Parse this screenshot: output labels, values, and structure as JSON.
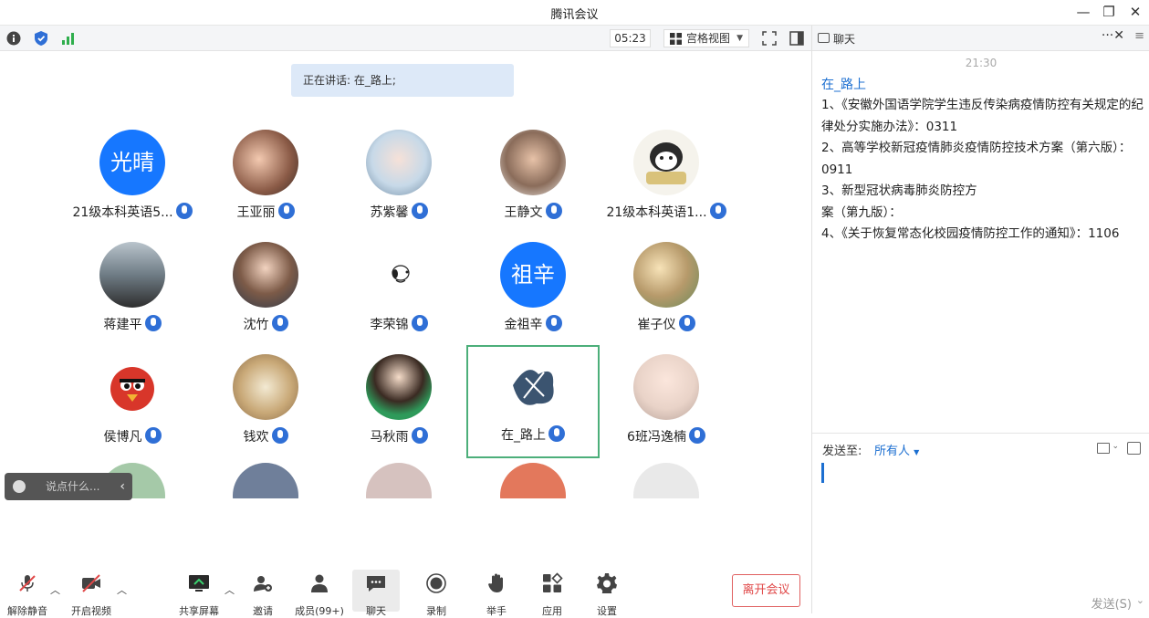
{
  "window": {
    "title": "腾讯会议"
  },
  "toolbar": {
    "timer": "05:23",
    "view_label": "宫格视图"
  },
  "speaking": {
    "text": "正在讲话: 在_路上;"
  },
  "participants": [
    {
      "name": "21级本科英语5...",
      "avatar_text": "光晴",
      "avatar_color": "#1677ff"
    },
    {
      "name": "王亚丽"
    },
    {
      "name": "苏紫馨"
    },
    {
      "name": "王静文"
    },
    {
      "name": "21级本科英语1..."
    },
    {
      "name": "蒋建平"
    },
    {
      "name": "沈竹"
    },
    {
      "name": "李荣锦"
    },
    {
      "name": "金祖辛",
      "avatar_text": "祖辛",
      "avatar_color": "#1677ff"
    },
    {
      "name": "崔子仪"
    },
    {
      "name": "侯博凡"
    },
    {
      "name": "钱欢"
    },
    {
      "name": "马秋雨"
    },
    {
      "name": "在_路上",
      "active": true
    },
    {
      "name": "6班冯逸楠"
    }
  ],
  "chat_input_overlay": {
    "placeholder": "说点什么..."
  },
  "bottombar": {
    "unmute": "解除静音",
    "video": "开启视频",
    "share": "共享屏幕",
    "invite": "邀请",
    "members": "成员(99+)",
    "chat": "聊天",
    "record": "录制",
    "hand": "举手",
    "apps": "应用",
    "settings": "设置",
    "leave": "离开会议"
  },
  "chat": {
    "title": "聊天",
    "time": "21:30",
    "sender": "在_路上",
    "lines": [
      "1、《安徽外国语学院学生违反传染病疫情防控有关规定的纪律处分实施办法》：0311",
      "2、高等学校新冠疫情肺炎疫情防控技术方案（第六版）：0911",
      "3、新型冠状病毒肺炎防控方",
      "案（第九版）：",
      "4、《关于恢复常态化校园疫情防控工作的通知》：1106"
    ],
    "send_to_label": "发送至:",
    "send_to_value": "所有人",
    "send_button": "发送(S)"
  },
  "colors": {
    "accent": "#1677ff",
    "active_border": "#4caf7a",
    "leave": "#e04848"
  }
}
